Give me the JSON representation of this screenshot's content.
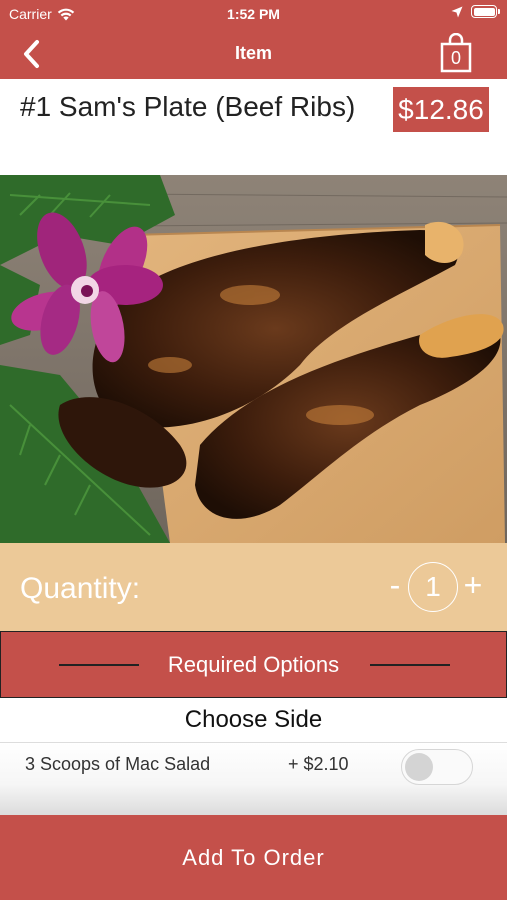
{
  "status_bar": {
    "carrier": "Carrier",
    "time": "1:52 PM"
  },
  "navbar": {
    "title": "Item",
    "cart_count": "0"
  },
  "item": {
    "title": "#1 Sam's Plate (Beef Ribs)",
    "price": "$12.86"
  },
  "quantity": {
    "label": "Quantity:",
    "minus": "-",
    "value": "1",
    "plus": "+"
  },
  "required_options": {
    "label": "Required Options",
    "group_title": "Choose Side",
    "options": [
      {
        "name": "3 Scoops of Mac Salad",
        "price": "+ $2.10",
        "selected": false
      }
    ]
  },
  "footer": {
    "add_button": "Add To Order"
  },
  "colors": {
    "brand_red": "#c4504a",
    "quantity_tan": "#ecc998"
  }
}
